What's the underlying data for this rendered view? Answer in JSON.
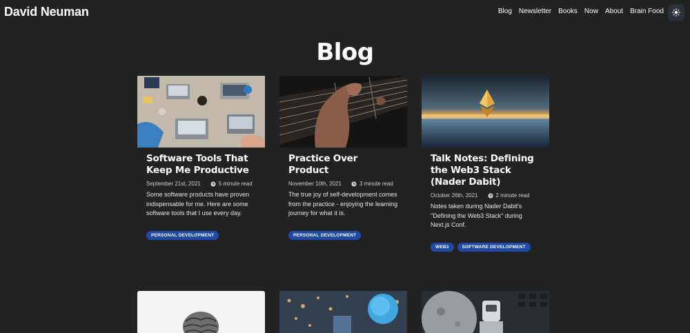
{
  "header": {
    "brand": "David Neuman",
    "nav": [
      "Blog",
      "Newsletter",
      "Books",
      "Now",
      "About",
      "Brain Food"
    ],
    "theme_toggle_icon": "sun-icon"
  },
  "page": {
    "title": "Blog"
  },
  "posts": [
    {
      "title": "Software Tools That Keep Me Productive",
      "date": "September 21st, 2021",
      "read_time": "5 minute read",
      "excerpt": "Some software products have proven indispensable for me. Here are some software tools that I use every day.",
      "tags": [
        "PERSONAL DEVELOPMENT"
      ],
      "image": "desk-with-laptops-image"
    },
    {
      "title": "Practice Over Product",
      "date": "November 10th, 2021",
      "read_time": "3 minute read",
      "excerpt": "The true joy of self-development comes from the practice - enjoying the learning journey for what it is.",
      "tags": [
        "PERSONAL DEVELOPMENT"
      ],
      "image": "guitar-fretboard-image"
    },
    {
      "title": "Talk Notes: Defining the Web3 Stack (Nader Dabit)",
      "date": "October 26th, 2021",
      "read_time": "2 minute read",
      "excerpt": "Notes taken during Nader Dabit's \"Defining the Web3 Stack\" during Next.js Conf.",
      "tags": [
        "WEB3",
        "SOFTWARE DEVELOPMENT"
      ],
      "image": "ethereum-horizon-image"
    }
  ],
  "more_posts_images": [
    "brain-sculpture-image",
    "glowing-orb-bokeh-image",
    "robot-moon-image"
  ],
  "colors": {
    "background": "#222222",
    "tag": "#1f4aa8",
    "text": "#ffffff"
  }
}
